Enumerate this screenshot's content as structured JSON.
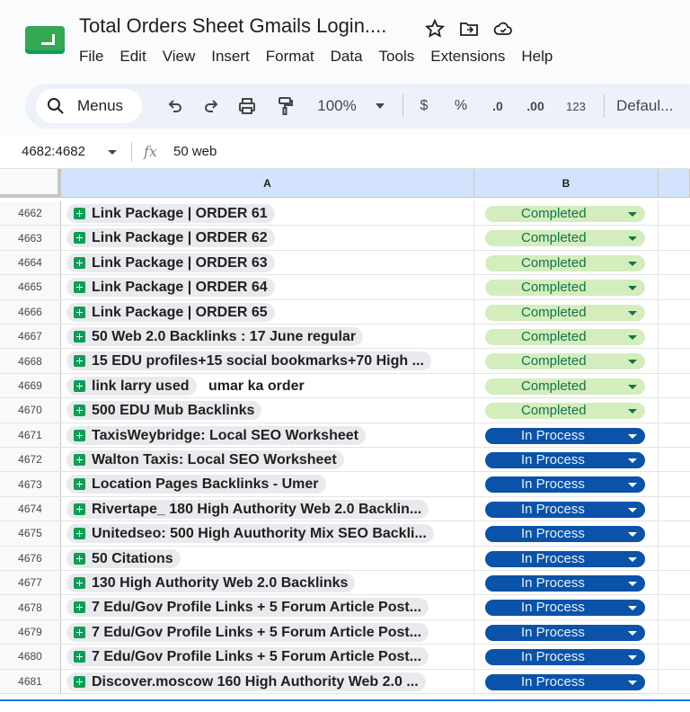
{
  "app": {
    "doc_title": "Total Orders Sheet Gmails Login....",
    "menus": [
      "File",
      "Edit",
      "View",
      "Insert",
      "Format",
      "Data",
      "Tools",
      "Extensions",
      "Help"
    ]
  },
  "toolbar": {
    "search_label": "Menus",
    "zoom": "100%",
    "currency": "$",
    "percent": "%",
    "dec_decrease": ".0",
    "dec_increase": ".00",
    "number_format": "123",
    "font": "Defaul..."
  },
  "formula_bar": {
    "name_box": "4682:4682",
    "fx": "fx",
    "value": "50 web"
  },
  "columns": [
    "A",
    "B"
  ],
  "rows": [
    {
      "num": "4662",
      "a": "Link Package | ORDER 61",
      "b": "Completed",
      "state": "done"
    },
    {
      "num": "4663",
      "a": "Link Package | ORDER 62",
      "b": "Completed",
      "state": "done"
    },
    {
      "num": "4664",
      "a": "Link Package | ORDER 63",
      "b": "Completed",
      "state": "done"
    },
    {
      "num": "4665",
      "a": "Link Package | ORDER 64",
      "b": "Completed",
      "state": "done"
    },
    {
      "num": "4666",
      "a": "Link Package | ORDER 65",
      "b": "Completed",
      "state": "done"
    },
    {
      "num": "4667",
      "a": "50 Web 2.0 Backlinks : 17 June regular",
      "b": "Completed",
      "state": "done"
    },
    {
      "num": "4668",
      "a": "15 EDU profiles+15 social bookmarks+70 High ...",
      "b": "Completed",
      "state": "done"
    },
    {
      "num": "4669",
      "a": "link larry used",
      "extra": "umar ka order",
      "b": "Completed",
      "state": "done"
    },
    {
      "num": "4670",
      "a": "500 EDU Mub Backlinks",
      "b": "Completed",
      "state": "done"
    },
    {
      "num": "4671",
      "a": "TaxisWeybridge:  Local SEO Worksheet",
      "b": "In Process",
      "state": "proc"
    },
    {
      "num": "4672",
      "a": "Walton Taxis: Local SEO Worksheet",
      "b": "In Process",
      "state": "proc"
    },
    {
      "num": "4673",
      "a": "Location Pages Backlinks - Umer",
      "b": "In Process",
      "state": "proc"
    },
    {
      "num": "4674",
      "a": "Rivertape_ 180 High Authority Web 2.0 Backlin...",
      "b": "In Process",
      "state": "proc"
    },
    {
      "num": "4675",
      "a": "Unitedseo: 500 High Auuthority Mix SEO Backli...",
      "b": "In Process",
      "state": "proc"
    },
    {
      "num": "4676",
      "a": "50 Citations",
      "b": "In Process",
      "state": "proc"
    },
    {
      "num": "4677",
      "a": "130 High Authority Web 2.0 Backlinks",
      "b": "In Process",
      "state": "proc"
    },
    {
      "num": "4678",
      "a": "7 Edu/Gov Profile Links + 5 Forum Article Post...",
      "b": "In Process",
      "state": "proc"
    },
    {
      "num": "4679",
      "a": "7 Edu/Gov Profile Links + 5 Forum Article Post...",
      "b": "In Process",
      "state": "proc"
    },
    {
      "num": "4680",
      "a": "7 Edu/Gov Profile Links + 5 Forum Article Post...",
      "b": "In Process",
      "state": "proc"
    },
    {
      "num": "4681",
      "a": "Discover.moscow 160 High Authority Web 2.0 ...",
      "b": "In Process",
      "state": "proc"
    }
  ],
  "colors": {
    "completed_bg": "#d4edbc",
    "completed_text": "#11734b",
    "in_process_bg": "#0a53a8",
    "in_process_text": "#e8f0fe",
    "header_selected": "#d3e3fd"
  },
  "icons": [
    "sheets-logo-icon",
    "star-icon",
    "move-folder-icon",
    "cloud-status-icon",
    "search-icon",
    "undo-icon",
    "redo-icon",
    "print-icon",
    "paint-format-icon",
    "dropdown-arrow-icon",
    "sheet-link-icon"
  ]
}
